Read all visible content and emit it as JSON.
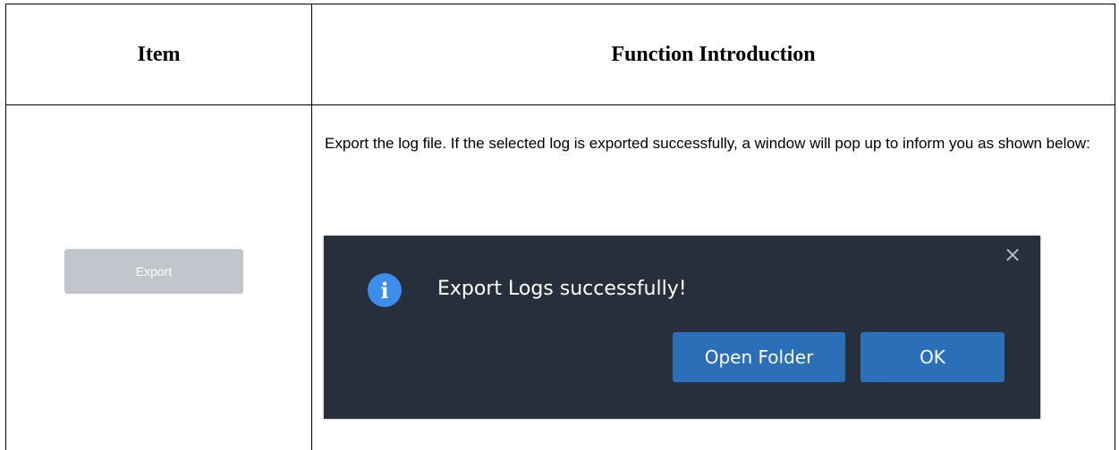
{
  "table": {
    "headers": {
      "item": "Item",
      "function": "Function Introduction"
    },
    "row": {
      "item_button_label": "Export",
      "description": "Export the log file. If the selected log is exported successfully, a window will pop up to inform you as shown below:"
    }
  },
  "dialog": {
    "close_icon": "close-icon",
    "info_icon": "info-icon",
    "info_glyph": "i",
    "close_glyph": "×",
    "message": "Export Logs successfully!",
    "buttons": {
      "open_folder": "Open Folder",
      "ok": "OK"
    },
    "colors": {
      "background": "#272f3c",
      "accent": "#2a6fb8",
      "info": "#3d8eea"
    }
  }
}
